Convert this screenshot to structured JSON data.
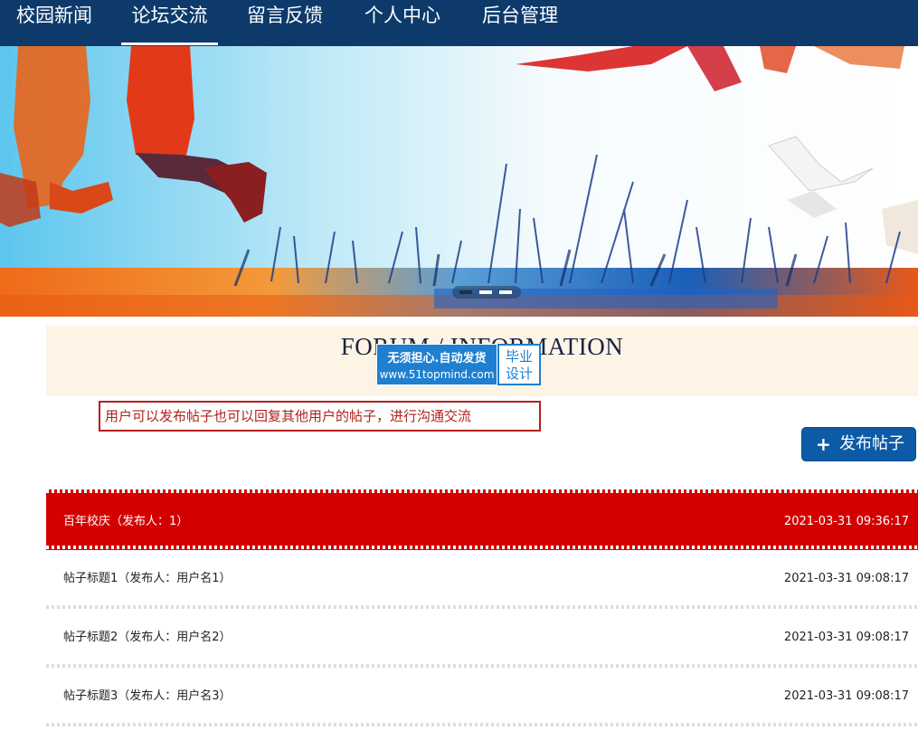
{
  "nav": {
    "items": [
      {
        "label": "校园新闻"
      },
      {
        "label": "论坛交流",
        "active": true
      },
      {
        "label": "留言反馈"
      },
      {
        "label": "个人中心"
      },
      {
        "label": "后台管理"
      }
    ]
  },
  "section": {
    "title": "FORUM / INFORMATION"
  },
  "watermark": {
    "line1": "无须担心.自动发货",
    "line2": "www.51topmind.com",
    "badge_line1": "毕业",
    "badge_line2": "设计"
  },
  "note": "用户可以发布帖子也可以回复其他用户的帖子，进行沟通交流",
  "post_button": {
    "label": "发布帖子",
    "icon": "plus-icon"
  },
  "carousel": {
    "slide_count": 3,
    "active_index": 0
  },
  "posts": [
    {
      "title": "百年校庆（发布人：1）",
      "time": "2021-03-31 09:36:17",
      "highlighted": true
    },
    {
      "title": "帖子标题1（发布人：用户名1）",
      "time": "2021-03-31 09:08:17"
    },
    {
      "title": "帖子标题2（发布人：用户名2）",
      "time": "2021-03-31 09:08:17"
    },
    {
      "title": "帖子标题3（发布人：用户名3）",
      "time": "2021-03-31 09:08:17"
    }
  ],
  "colors": {
    "nav_bg": "#0d3a6b",
    "highlight_row": "#d40000",
    "button_blue": "#0d5ba6",
    "note_red": "#b3201c",
    "title_bg": "#fdf4e6"
  }
}
